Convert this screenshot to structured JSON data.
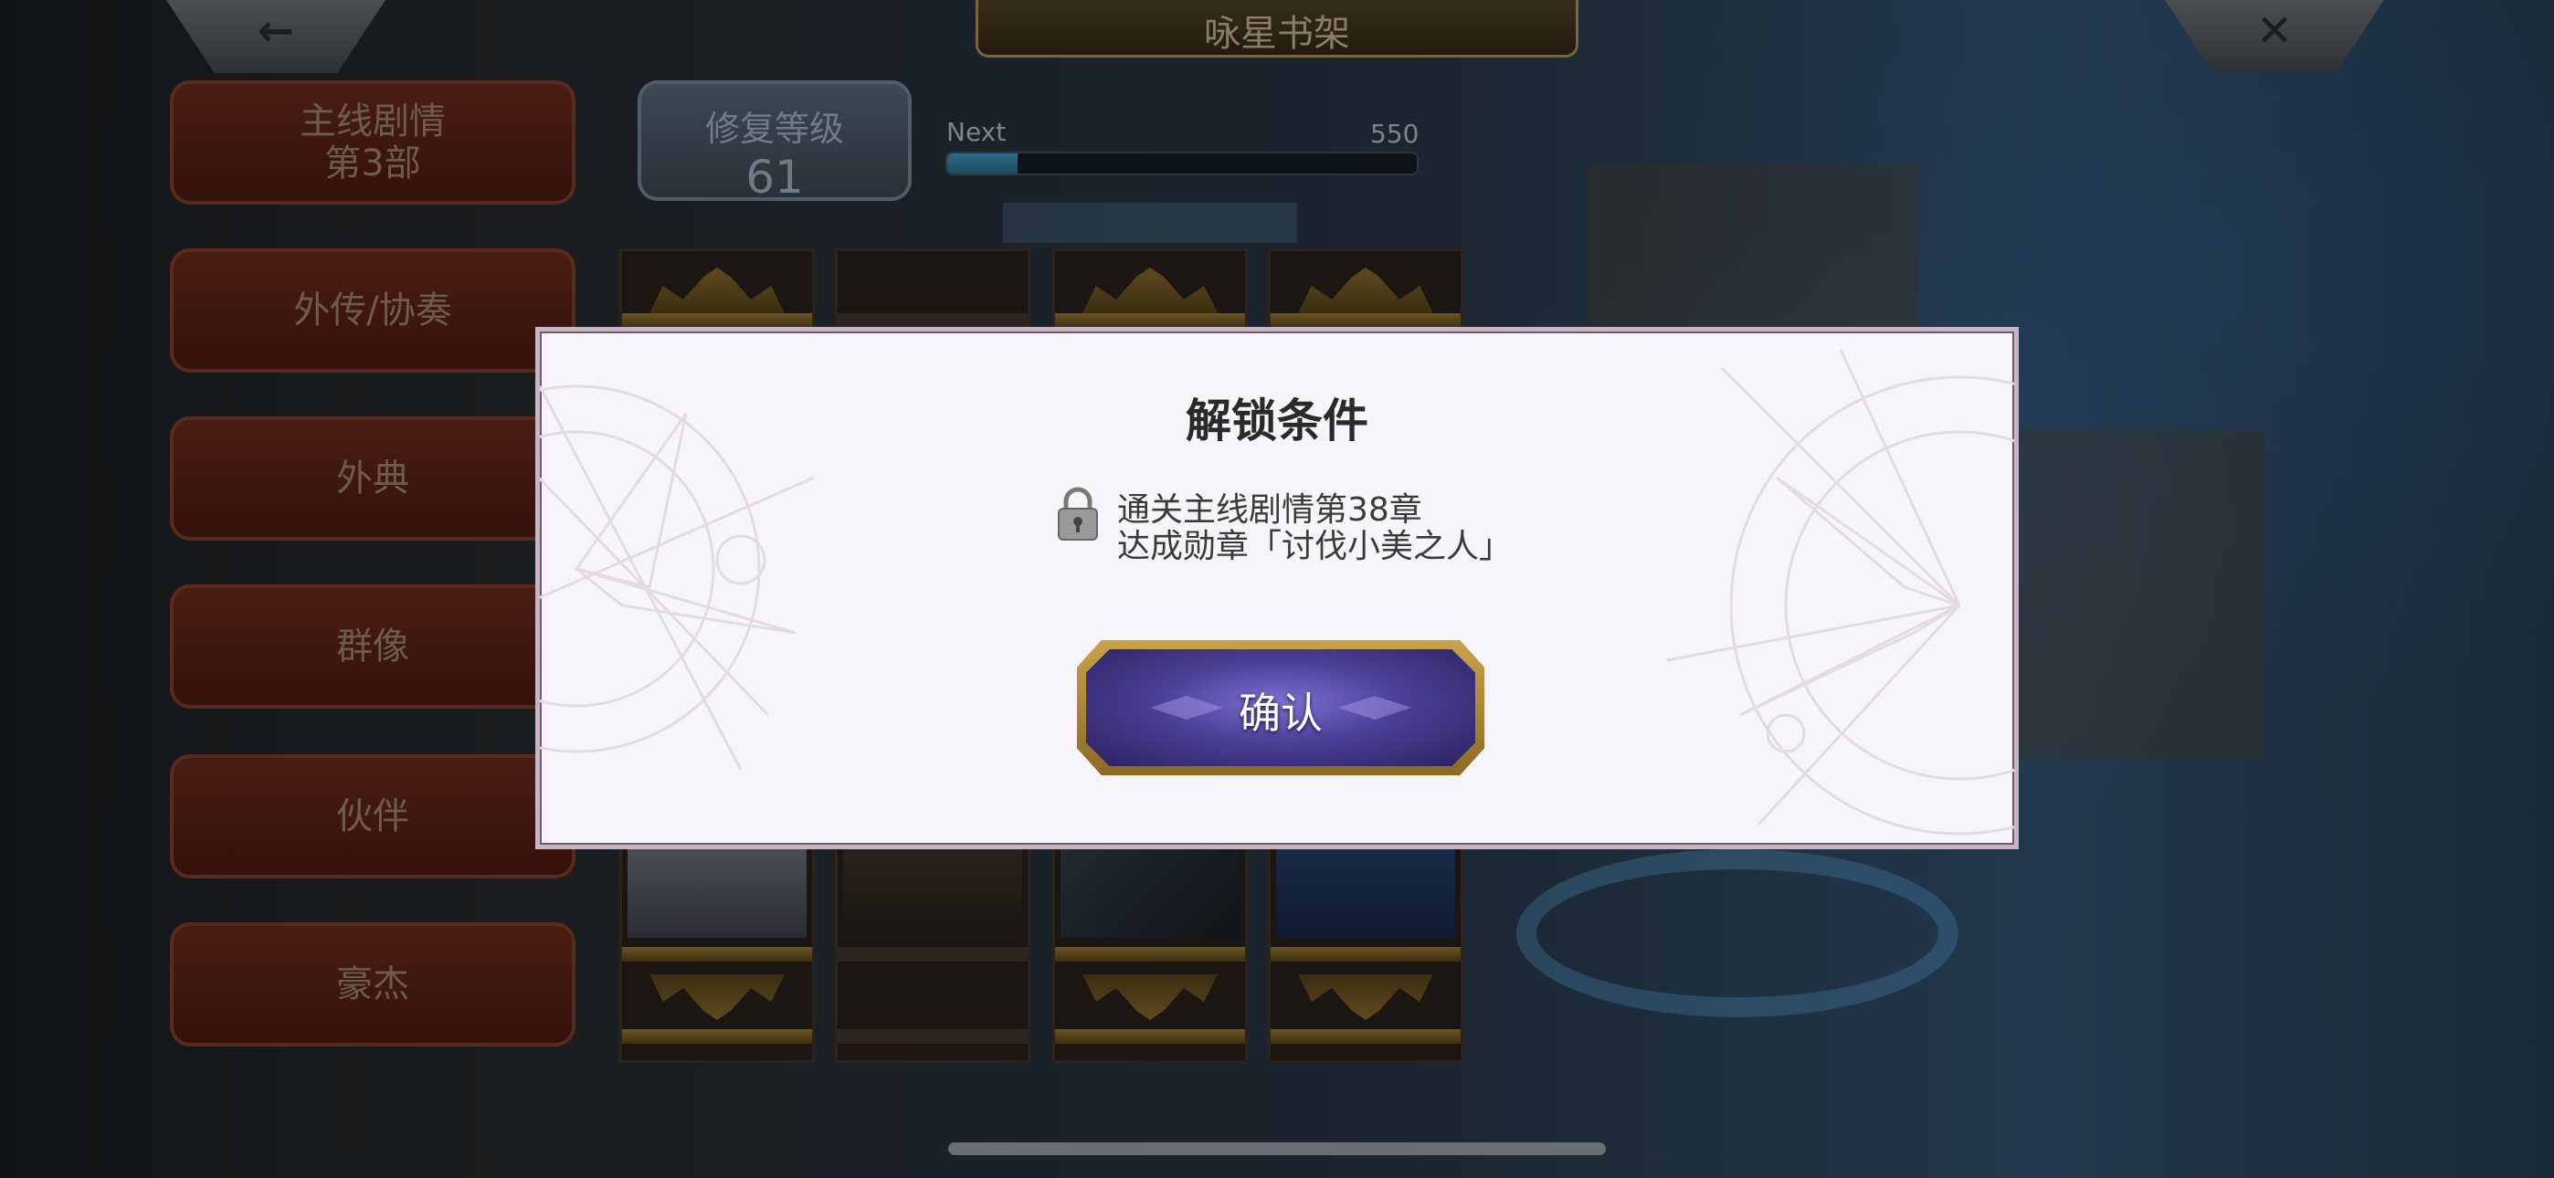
{
  "header": {
    "title": "咏星书架",
    "back_icon": "←",
    "close_icon": "✕"
  },
  "sidebar": {
    "items": [
      {
        "label": "主线剧情\n第3部"
      },
      {
        "label": "外传/协奏"
      },
      {
        "label": "外典"
      },
      {
        "label": "群像"
      },
      {
        "label": "伙伴"
      },
      {
        "label": "豪杰"
      }
    ]
  },
  "repair": {
    "label": "修复等级",
    "level": "61",
    "next_label": "Next",
    "next_value": "550",
    "progress_fraction": 0.15
  },
  "dialog": {
    "title": "解锁条件",
    "conditions": [
      "通关主线剧情第38章",
      "达成勋章「讨伐小美之人」"
    ],
    "confirm_label": "确认"
  },
  "colors": {
    "dialog_bg": "#f8f5fa",
    "confirm_gold": "#c9a24a",
    "confirm_purple": "#4a3f96",
    "sidebar_red": "#4a1d14"
  }
}
